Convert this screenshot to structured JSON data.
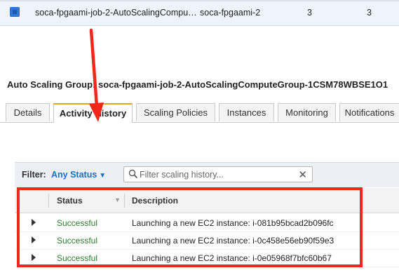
{
  "top_row": {
    "name": "soca-fpgaami-job-2-AutoScalingCompu…",
    "launch_config": "soca-fpgaami-2",
    "count_a": "3",
    "count_b": "3"
  },
  "group_title": "Auto Scaling Group: soca-fpgaami-job-2-AutoScalingComputeGroup-1CSM78WBSE1O1",
  "tabs": [
    {
      "label": "Details"
    },
    {
      "label": "Activity History"
    },
    {
      "label": "Scaling Policies"
    },
    {
      "label": "Instances"
    },
    {
      "label": "Monitoring"
    },
    {
      "label": "Notifications"
    }
  ],
  "active_tab": "Activity History",
  "filter": {
    "label": "Filter:",
    "status_value": "Any Status",
    "search_placeholder": "Filter scaling history..."
  },
  "table": {
    "columns": [
      "Status",
      "Description"
    ],
    "rows": [
      {
        "status": "Successful",
        "description": "Launching a new EC2 instance: i-081b95bcad2b096fc"
      },
      {
        "status": "Successful",
        "description": "Launching a new EC2 instance: i-0c458e56eb90f59e3"
      },
      {
        "status": "Successful",
        "description": "Launching a new EC2 instance: i-0e05968f7bfc60b67"
      }
    ]
  },
  "colors": {
    "annotation_red": "#f0281a",
    "status_green": "#2b7a2b",
    "link_blue": "#1f6fbf",
    "tab_accent": "#e8a317"
  },
  "icons": [
    "checkbox-icon",
    "chevron-down-icon",
    "search-icon",
    "clear-icon",
    "expand-arrow-icon",
    "sort-icon",
    "annotation-arrow"
  ]
}
